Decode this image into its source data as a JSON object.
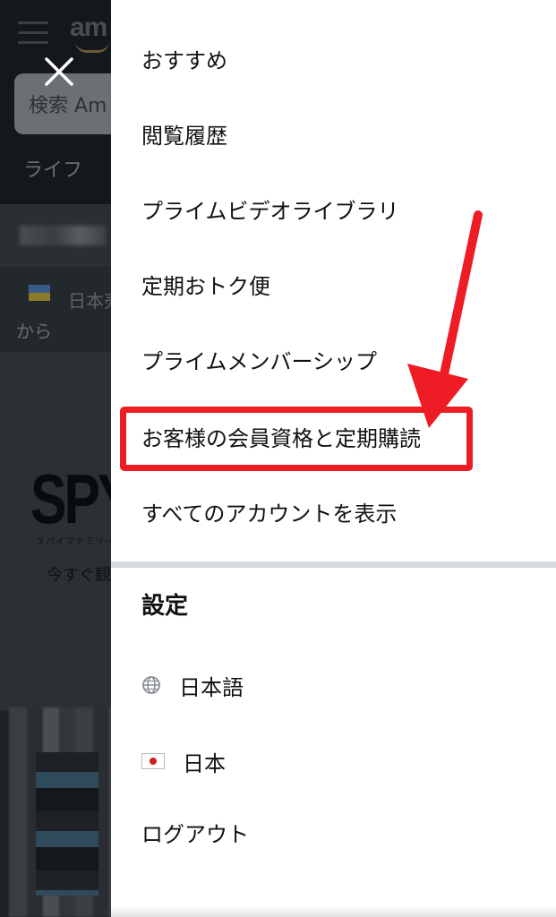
{
  "background": {
    "logo_text": "am",
    "search_placeholder": "検索 Am",
    "nav_text": "ライフ",
    "delivery_text": "",
    "banner_text": "日本売",
    "banner_text2": "から",
    "promo_title": "SPY",
    "promo_subtitle": "スパイファミリー",
    "promo_text": "今すぐ観"
  },
  "menu": {
    "items": [
      {
        "label": "おすすめ"
      },
      {
        "label": "閲覧履歴"
      },
      {
        "label": "プライムビデオライブラリ"
      },
      {
        "label": "定期おトク便"
      },
      {
        "label": "プライムメンバーシップ"
      },
      {
        "label": "お客様の会員資格と定期購読"
      },
      {
        "label": "すべてのアカウントを表示"
      }
    ]
  },
  "settings": {
    "heading": "設定",
    "language": "日本語",
    "country": "日本",
    "logout": "ログアウト"
  },
  "icons": {
    "close": "close-icon",
    "globe": "globe-icon",
    "flag": "japan-flag-icon",
    "menu": "hamburger-icon"
  },
  "colors": {
    "annotation_red": "#ee1c25",
    "drawer_bg": "#ffffff",
    "overlay_bg": "#1f2327",
    "divider": "#d5d9dc"
  }
}
